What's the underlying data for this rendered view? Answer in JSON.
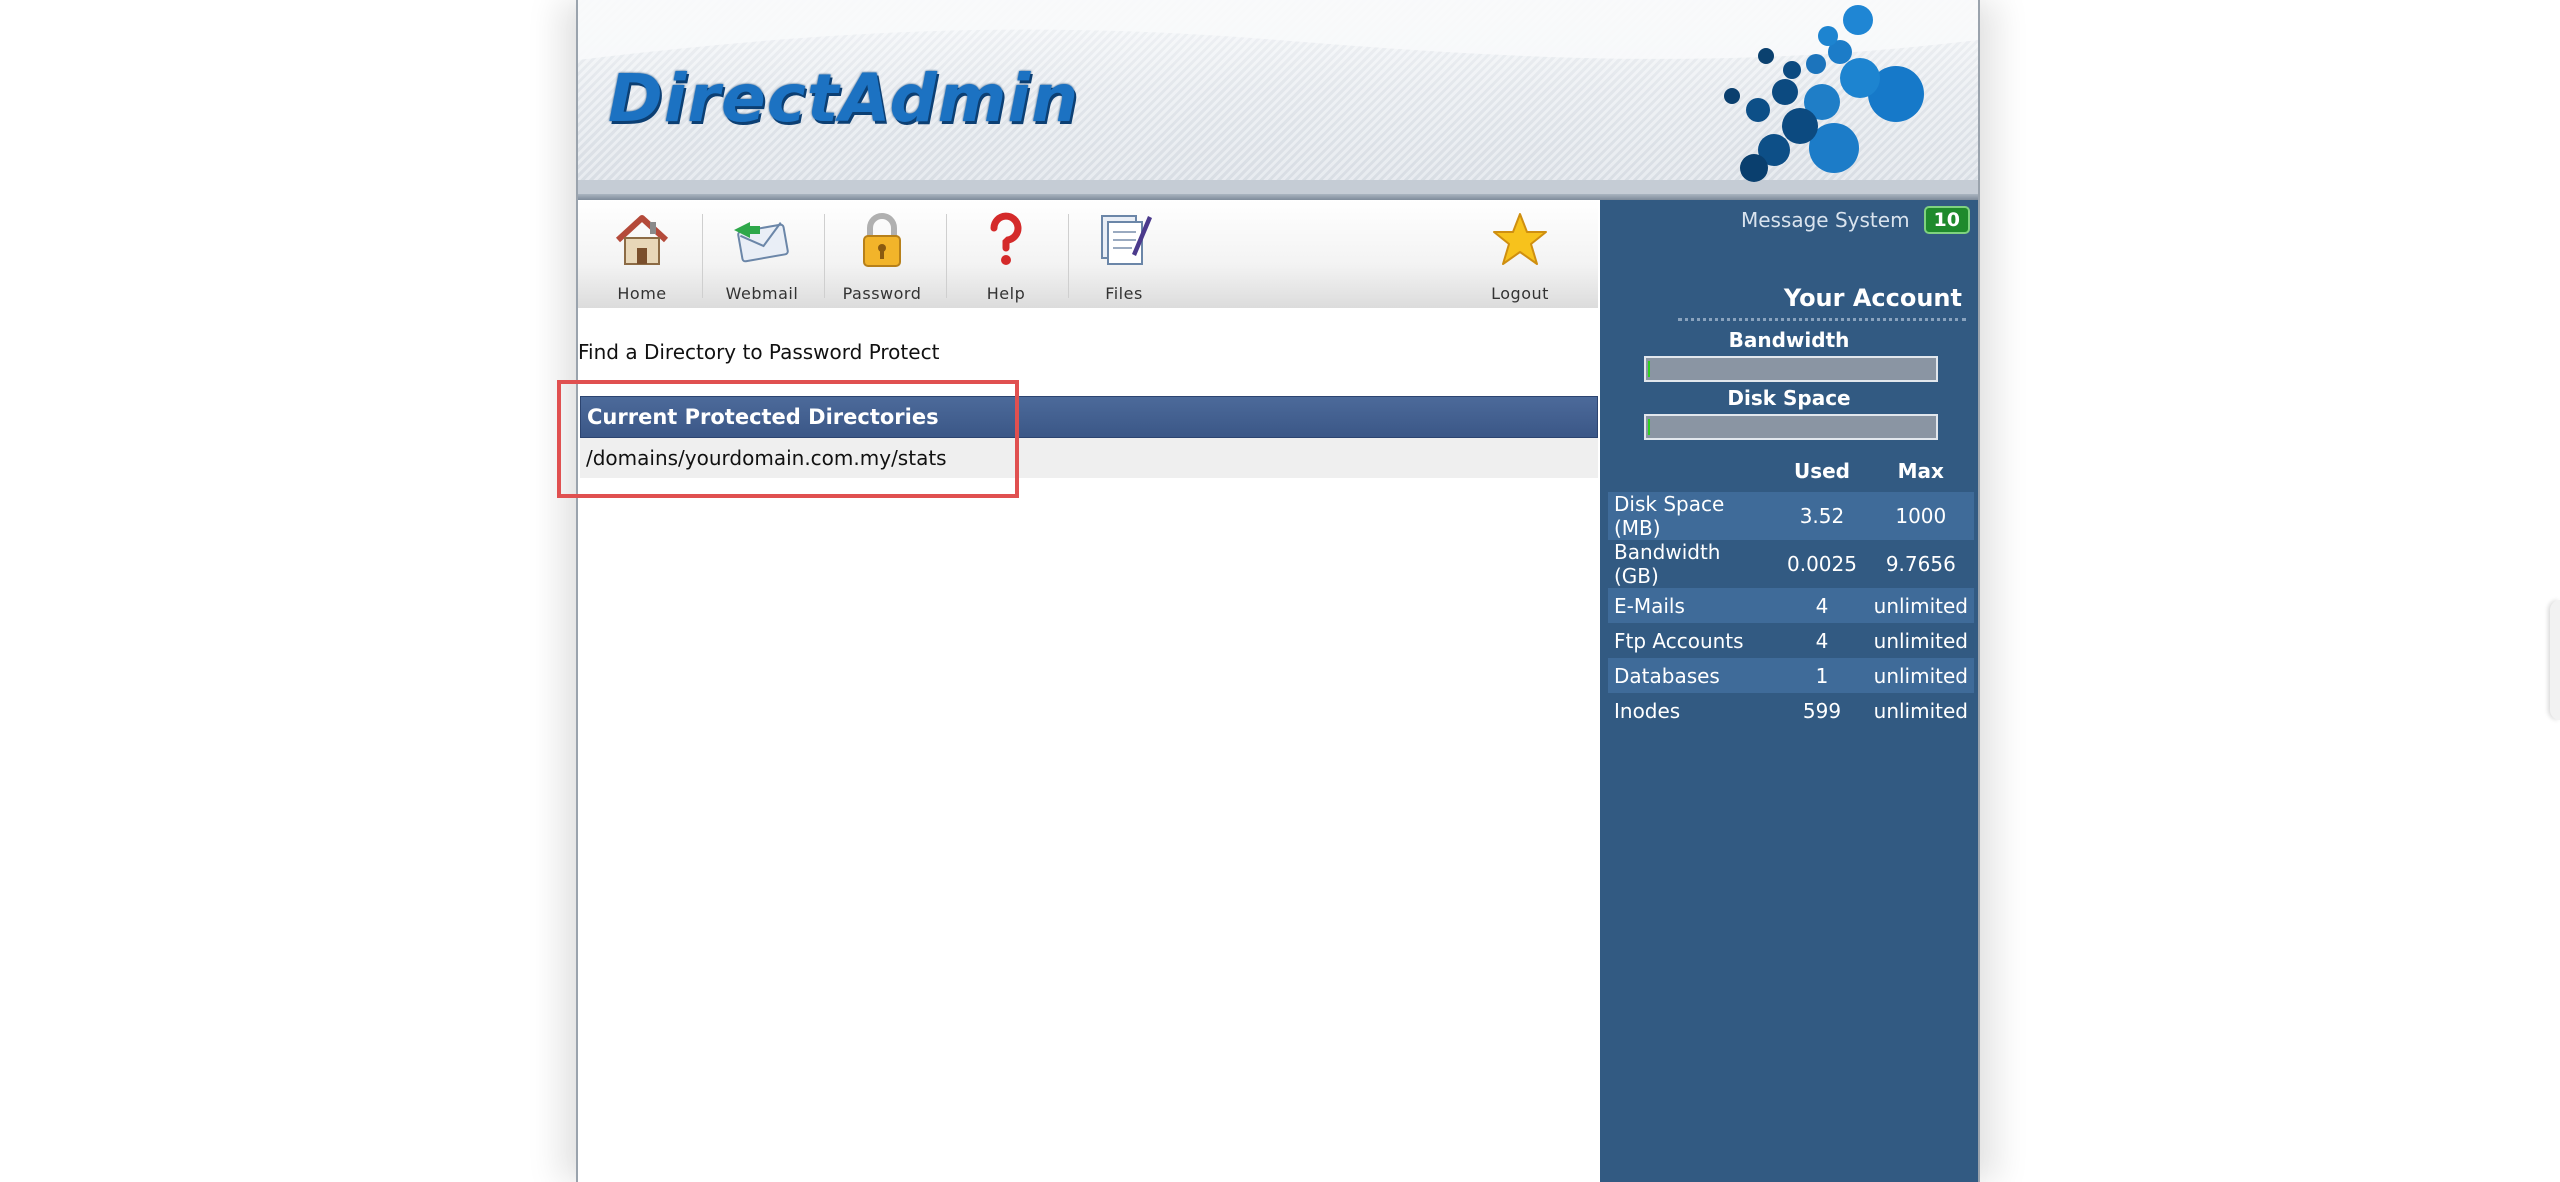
{
  "header": {
    "logo_text": "DirectAdmin"
  },
  "toolbar": {
    "items": [
      {
        "label": "Home",
        "icon": "home-icon"
      },
      {
        "label": "Webmail",
        "icon": "webmail-icon"
      },
      {
        "label": "Password",
        "icon": "lock-icon"
      },
      {
        "label": "Help",
        "icon": "help-icon"
      },
      {
        "label": "Files",
        "icon": "files-icon"
      },
      {
        "label": "Logout",
        "icon": "star-icon"
      }
    ]
  },
  "content": {
    "find_link": "Find a Directory to Password Protect",
    "table_header": "Current Protected Directories",
    "directories": [
      "/domains/yourdomain.com.my/stats"
    ]
  },
  "sidebar": {
    "message_label": "Message System",
    "message_count": "10",
    "account_title": "Your Account",
    "bandwidth_label": "Bandwidth",
    "disk_label": "Disk Space",
    "bandwidth_usage_fraction": 0.0003,
    "disk_usage_fraction": 0.0035,
    "col_used": "Used",
    "col_max": "Max",
    "rows": [
      {
        "label": "Disk Space (MB)",
        "used": "3.52",
        "max": "1000"
      },
      {
        "label": "Bandwidth (GB)",
        "used": "0.0025",
        "max": "9.7656"
      },
      {
        "label": "E-Mails",
        "used": "4",
        "max": "unlimited"
      },
      {
        "label": "Ftp Accounts",
        "used": "4",
        "max": "unlimited"
      },
      {
        "label": "Databases",
        "used": "1",
        "max": "unlimited"
      },
      {
        "label": "Inodes",
        "used": "599",
        "max": "unlimited"
      }
    ]
  },
  "colors": {
    "sidebar_bg": "#325a82",
    "table_header_bg": "#3b5787",
    "logo_blue": "#1c72c2",
    "highlight_red": "#e05050",
    "badge_green": "#1f8a2c"
  }
}
